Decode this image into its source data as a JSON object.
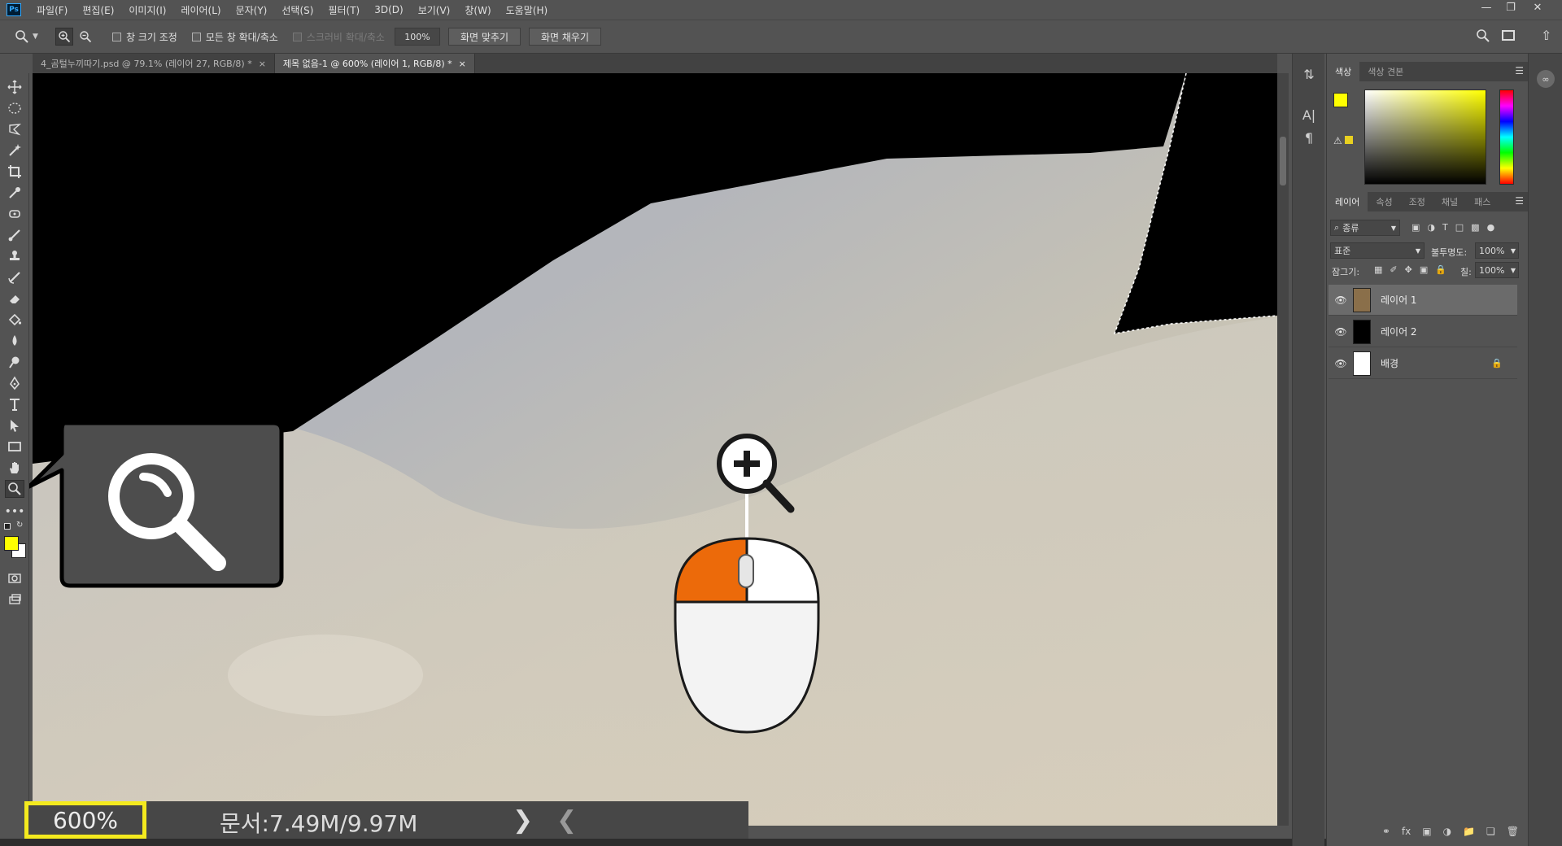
{
  "menubar": {
    "app_icon": "Ps",
    "items": [
      "파일(F)",
      "편집(E)",
      "이미지(I)",
      "레이어(L)",
      "문자(Y)",
      "선택(S)",
      "필터(T)",
      "3D(D)",
      "보기(V)",
      "창(W)",
      "도움말(H)"
    ]
  },
  "options": {
    "resize_windows": "창 크기 조정",
    "zoom_all_windows": "모든 창 확대/축소",
    "scrubby_zoom": "스크러비 확대/축소",
    "zoom_value": "100%",
    "fit_screen": "화면 맞추기",
    "fill_screen": "화면 채우기"
  },
  "tabs": [
    {
      "label": "4_곰털누끼따기.psd @ 79.1% (레이어 27, RGB/8) *",
      "active": false
    },
    {
      "label": "제목 없음-1 @ 600% (레이어 1, RGB/8) *",
      "active": true
    }
  ],
  "status": {
    "zoom": "600%",
    "doc": "문서:7.49M/9.97M"
  },
  "color_panel": {
    "tabs": [
      "색상",
      "색상 견본"
    ],
    "foreground": "#ffff00",
    "background": "#ffffff"
  },
  "layers_panel": {
    "tabs": [
      "레이어",
      "속성",
      "조정",
      "채널",
      "패스"
    ],
    "filter_label": "종류",
    "blend_mode": "표준",
    "opacity_label": "불투명도:",
    "opacity_value": "100%",
    "lock_label": "잠그기:",
    "fill_label": "칠:",
    "fill_value": "100%",
    "layers": [
      {
        "name": "레이어 1",
        "selected": true,
        "thumb": "#8a6f4a",
        "locked": false
      },
      {
        "name": "레이어 2",
        "selected": false,
        "thumb": "#000000",
        "locked": false
      },
      {
        "name": "배경",
        "selected": false,
        "thumb": "#ffffff",
        "locked": true
      }
    ]
  },
  "colors": {
    "highlight": "#f4ea1e",
    "mouse_button": "#ec6a0a"
  }
}
